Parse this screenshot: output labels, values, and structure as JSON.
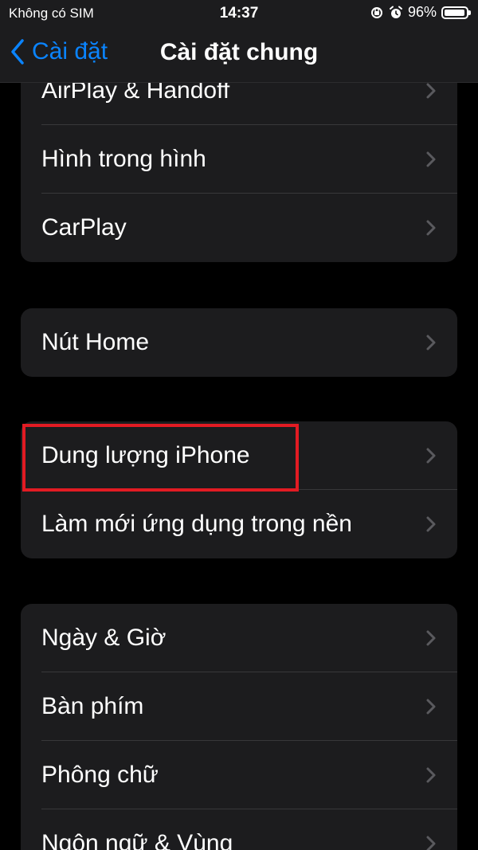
{
  "status_bar": {
    "carrier": "Không có SIM",
    "time": "14:37",
    "battery_percent": "96%",
    "battery_level": 0.96
  },
  "nav": {
    "back_label": "Cài đặt",
    "title": "Cài đặt chung"
  },
  "groups": [
    {
      "items": [
        {
          "label": "AirPlay & Handoff"
        },
        {
          "label": "Hình trong hình"
        },
        {
          "label": "CarPlay"
        }
      ]
    },
    {
      "items": [
        {
          "label": "Nút Home"
        }
      ]
    },
    {
      "items": [
        {
          "label": "Dung lượng iPhone",
          "highlighted": true
        },
        {
          "label": "Làm mới ứng dụng trong nền"
        }
      ]
    },
    {
      "items": [
        {
          "label": "Ngày & Giờ"
        },
        {
          "label": "Bàn phím"
        },
        {
          "label": "Phông chữ"
        },
        {
          "label": "Ngôn ngữ & Vùng"
        }
      ]
    }
  ],
  "colors": {
    "accent": "#0a84ff",
    "highlight_border": "#e21b23",
    "cell_background": "#1c1c1e"
  }
}
